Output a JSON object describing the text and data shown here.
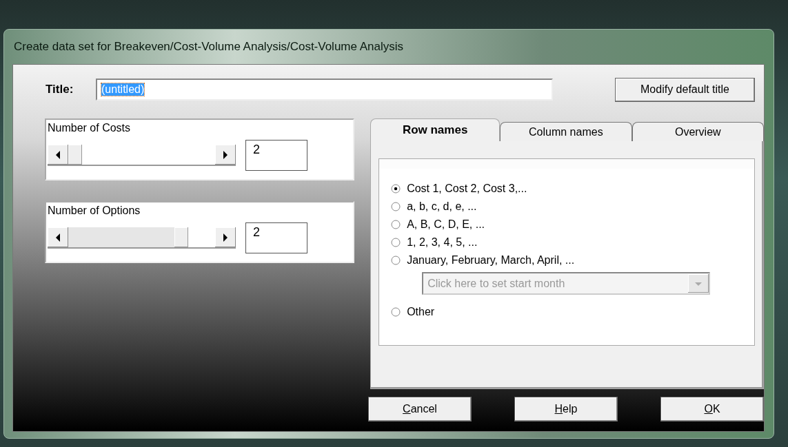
{
  "window": {
    "title": "Create data set for Breakeven/Cost-Volume Analysis/Cost-Volume Analysis"
  },
  "title_field": {
    "label": "Title:",
    "value": "(untitled)"
  },
  "modify_button": "Modify default title",
  "groups": [
    {
      "label": "Number of Costs",
      "level": 0,
      "value": "2"
    },
    {
      "label": "Number of Options",
      "level": 0.8,
      "value": "2"
    }
  ],
  "tabs": [
    {
      "label": "Row names",
      "selected": true
    },
    {
      "label": "Column names",
      "selected": false
    },
    {
      "label": "Overview",
      "selected": false
    }
  ],
  "options": [
    {
      "label": "Cost 1, Cost 2, Cost 3,...",
      "selected": true
    },
    {
      "label": "a, b, c, d, e, ...",
      "selected": false
    },
    {
      "label": "A, B, C, D, E, ...",
      "selected": false
    },
    {
      "label": "1, 2, 3, 4, 5, ...",
      "selected": false
    },
    {
      "label": "January, February, March, April, ...",
      "selected": false,
      "dropdown": {
        "placeholder": "Click here to set start month",
        "disabled": true
      }
    },
    {
      "label": "Other",
      "selected": false
    }
  ],
  "buttons": [
    {
      "mnemonic": "C",
      "rest": "ancel"
    },
    {
      "mnemonic": "H",
      "rest": "elp"
    },
    {
      "mnemonic": "O",
      "rest": "K"
    }
  ]
}
